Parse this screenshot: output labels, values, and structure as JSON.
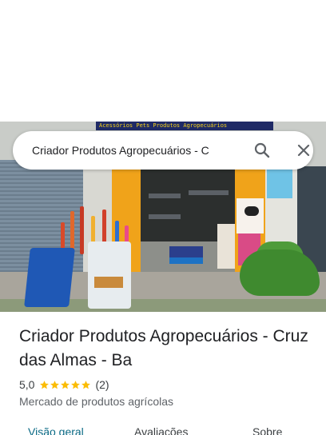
{
  "photo": {
    "sign_text": "Acessórios Pets   Produtos Agropecuários"
  },
  "search": {
    "query": "Criador Produtos Agropecuários - C",
    "search_icon": "search-icon",
    "close_icon": "close-icon"
  },
  "place": {
    "name": "Criador Produtos Agropecuários - Cruz das Almas - Ba",
    "rating": "5,0",
    "rating_stars": 5,
    "review_count": "(2)",
    "category": "Mercado de produtos agrícolas"
  },
  "tabs": [
    {
      "label": "Visão geral",
      "active": true
    },
    {
      "label": "Avaliações",
      "active": false
    },
    {
      "label": "Sobre",
      "active": false
    }
  ],
  "colors": {
    "star": "#fbbc04",
    "active_tab": "#0b6a85",
    "title": "#202124",
    "secondary": "#5f6368"
  }
}
